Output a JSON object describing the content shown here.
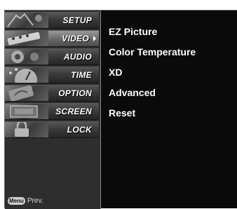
{
  "sidebar": {
    "items": [
      {
        "label": "SETUP",
        "icon": "setup-icon",
        "selected": false
      },
      {
        "label": "VIDEO",
        "icon": "video-icon",
        "selected": true
      },
      {
        "label": "AUDIO",
        "icon": "audio-icon",
        "selected": false
      },
      {
        "label": "TIME",
        "icon": "time-icon",
        "selected": false
      },
      {
        "label": "OPTION",
        "icon": "option-icon",
        "selected": false
      },
      {
        "label": "SCREEN",
        "icon": "screen-icon",
        "selected": false
      },
      {
        "label": "LOCK",
        "icon": "lock-icon",
        "selected": false
      }
    ],
    "hint": {
      "key": "Menu",
      "text": "Prev."
    }
  },
  "submenu": {
    "items": [
      "EZ Picture",
      "Color Temperature",
      "XD",
      "Advanced",
      "Reset"
    ]
  }
}
